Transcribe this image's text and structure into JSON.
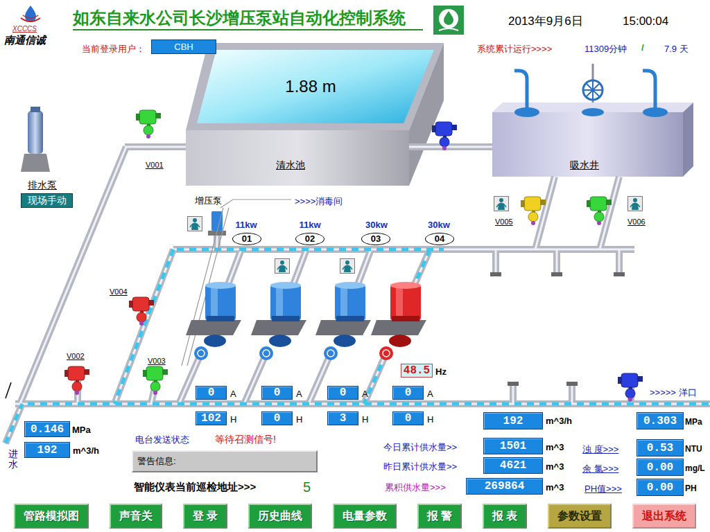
{
  "header": {
    "logo_text": "XCCCS",
    "company": "南通信诚",
    "title": "如东自来水公司长沙增压泵站自动化控制系统",
    "date": "2013年9月6日",
    "time": "15:00:04"
  },
  "session": {
    "user_label": "当前登录用户：",
    "user": "CBH",
    "runtime_label": "系统累计运行>>>>",
    "runtime_minutes": "11309分钟",
    "separator": "/",
    "runtime_days": "7.9 天"
  },
  "clear_tank": {
    "name": "清水池",
    "level": "1.88 m"
  },
  "suction_well": {
    "name": "吸水井"
  },
  "drain_pump": {
    "name": "排水泵",
    "mode": "现场手动"
  },
  "booster_pump": {
    "name": "增压泵",
    "target": ">>>>消毒间"
  },
  "pumps": [
    {
      "power": "11kw",
      "number": "01",
      "running": false,
      "current": "0",
      "current_unit": "A",
      "hours": "102",
      "hours_unit": "H"
    },
    {
      "power": "11kw",
      "number": "02",
      "running": false,
      "current": "0",
      "current_unit": "A",
      "hours": "0",
      "hours_unit": "H"
    },
    {
      "power": "30kw",
      "number": "03",
      "running": false,
      "current": "0",
      "current_unit": "A",
      "hours": "3",
      "hours_unit": "H"
    },
    {
      "power": "30kw",
      "number": "04",
      "running": true,
      "current": "0",
      "current_unit": "A",
      "hours": "0",
      "hours_unit": "H",
      "frequency": "48.5",
      "frequency_unit": "Hz"
    }
  ],
  "valves": [
    {
      "label": "V001",
      "color": "#37d63a"
    },
    {
      "label": "",
      "color": "#2b3fe0"
    },
    {
      "label": "V005",
      "color": "#f0d020"
    },
    {
      "label": "V006",
      "color": "#37d63a"
    },
    {
      "label": "V004",
      "color": "#e53030"
    },
    {
      "label": "V002",
      "color": "#e53030"
    },
    {
      "label": "V003",
      "color": "#37d63a"
    },
    {
      "label": "",
      "color": "#2b3fe0"
    }
  ],
  "inlet": {
    "label": "进水",
    "pressure": "0.146",
    "pressure_unit": "MPa",
    "flow": "192",
    "flow_unit": "m^3/h"
  },
  "outlet": {
    "destination": ">>>>> 洋口",
    "flow": "192",
    "flow_unit": "m^3/h",
    "pressure": "0.303",
    "pressure_unit": "MPa"
  },
  "radio": {
    "label": "电台发送状态",
    "status": "等待召测信号!"
  },
  "warning": {
    "label": "警告信息:"
  },
  "polling": {
    "label": "智能仪表当前巡检地址>>>",
    "address": "5"
  },
  "totals": [
    {
      "label": "今日累计供水量>>",
      "value": "1501",
      "unit": "m^3",
      "color": "#1020c0"
    },
    {
      "label": "昨日累计供水量>>",
      "value": "4621",
      "unit": "m^3",
      "color": "#1020c0"
    },
    {
      "label": "累积供水量>>>",
      "value": "269864",
      "unit": "m^3",
      "color": "#c010c0"
    }
  ],
  "quality": [
    {
      "label": "浊 度>>>",
      "value": "0.53",
      "unit": "NTU"
    },
    {
      "label": "余 氯>>>",
      "value": "0.00",
      "unit": "mg/L"
    },
    {
      "label": "PH值>>>",
      "value": "0.00",
      "unit": "PH"
    }
  ],
  "buttons": [
    {
      "label": "管路模拟图",
      "kind": "normal"
    },
    {
      "label": "声音关",
      "kind": "normal"
    },
    {
      "label": "登 录",
      "kind": "normal"
    },
    {
      "label": "历史曲线",
      "kind": "normal"
    },
    {
      "label": "电量参数",
      "kind": "normal"
    },
    {
      "label": "报 警",
      "kind": "normal"
    },
    {
      "label": "报 表",
      "kind": "normal"
    },
    {
      "label": "参数设置",
      "kind": "settings"
    },
    {
      "label": "退出系统",
      "kind": "exit"
    }
  ]
}
